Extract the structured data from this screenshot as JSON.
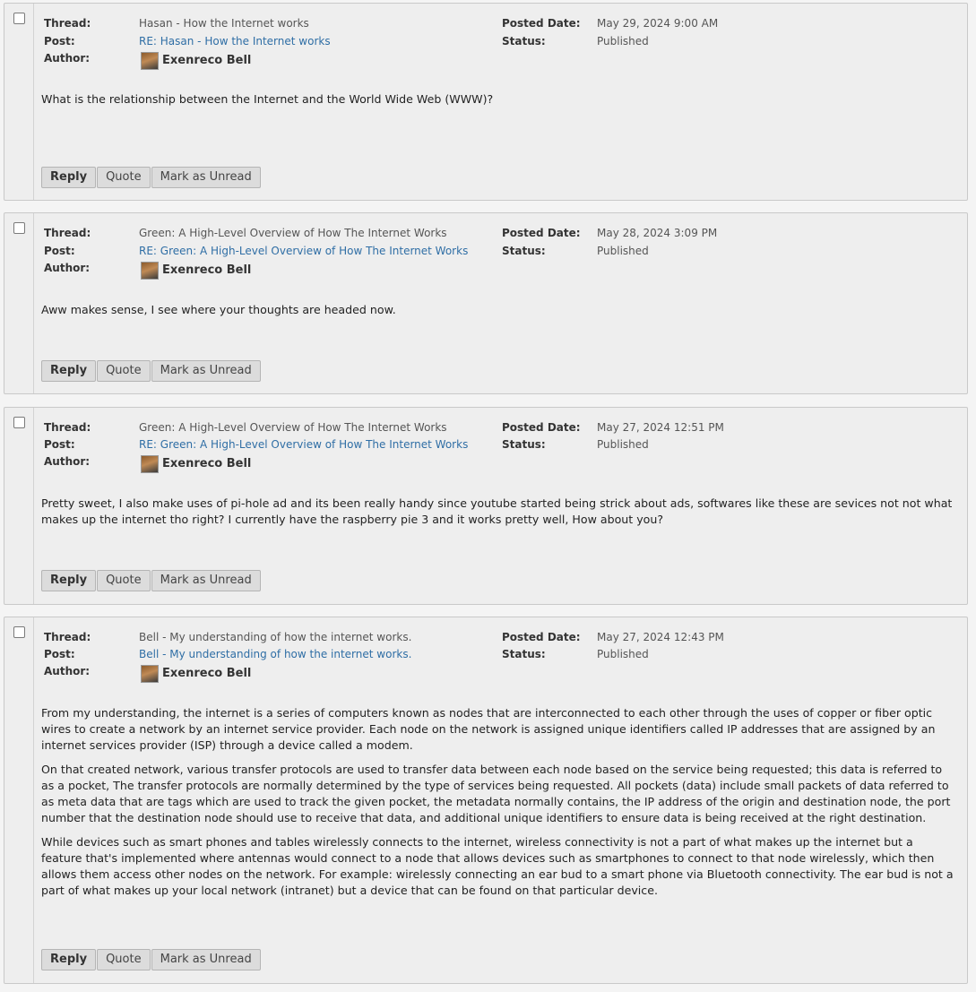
{
  "labels": {
    "thread": "Thread:",
    "post": "Post:",
    "author": "Author:",
    "posted_date": "Posted Date:",
    "status": "Status:"
  },
  "buttons": {
    "reply": "Reply",
    "quote": "Quote",
    "mark_unread": "Mark as Unread"
  },
  "posts": [
    {
      "thread": "Hasan - How the Internet works",
      "post": "RE: Hasan - How the Internet works",
      "author": "Exenreco Bell",
      "posted_date": "May 29, 2024 9:00 AM",
      "status": "Published",
      "paragraphs": [
        "What is the relationship between the Internet and the World Wide Web (WWW)?"
      ]
    },
    {
      "thread": "Green: A High-Level Overview of How The Internet Works",
      "post": "RE: Green: A High-Level Overview of How The Internet Works",
      "author": "Exenreco Bell",
      "posted_date": "May 28, 2024 3:09 PM",
      "status": "Published",
      "paragraphs": [
        "Aww makes sense, I see where your thoughts are headed now."
      ]
    },
    {
      "thread": "Green: A High-Level Overview of How The Internet Works",
      "post": "RE: Green: A High-Level Overview of How The Internet Works",
      "author": "Exenreco Bell",
      "posted_date": "May 27, 2024 12:51 PM",
      "status": "Published",
      "paragraphs": [
        "Pretty sweet, I also make uses of pi-hole ad and its been really handy since youtube started being strick about ads, softwares like these are sevices not not what makes up the internet tho right? I currently have the raspberry pie 3 and it works pretty well, How about you?"
      ]
    },
    {
      "thread": "Bell - My understanding of how the internet works.",
      "post": "Bell - My understanding of how the internet works.",
      "author": "Exenreco Bell",
      "posted_date": "May 27, 2024 12:43 PM",
      "status": "Published",
      "paragraphs": [
        "From my understanding, the internet is a series of computers known as nodes that are interconnected to each other through the uses of copper or fiber optic wires to create a network by an internet service provider. Each node on the network is assigned unique identifiers called IP addresses that are assigned by an internet services provider (ISP) through a device called a modem.",
        "On that created network, various transfer protocols are used to transfer data between each node based on the service being requested; this data is referred to as a pocket, The transfer protocols are normally determined by the type of services being requested. All pockets (data) include small packets of data referred to as meta data that are tags which are used to track the given pocket, the metadata normally contains, the IP address of the origin and destination node, the port number that the destination node should use to receive that data, and additional unique identifiers to ensure data is being received at the right destination.",
        "While devices such as smart phones and tables wirelessly connects to the internet, wireless connectivity is not a part of what makes up the internet but a feature that's implemented where antennas would connect to a node that allows devices such as smartphones to connect to that node wirelessly, which then allows them access other nodes on the network. For example: wirelessly connecting an ear bud to a smart phone via Bluetooth connectivity. The ear bud is not a part of what makes up your local network (intranet) but a device that can be found on that particular device."
      ]
    }
  ]
}
